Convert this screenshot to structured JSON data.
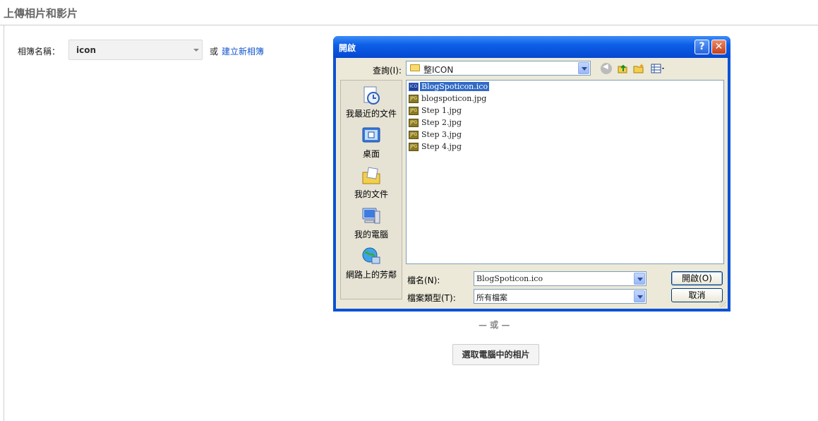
{
  "page": {
    "title": "上傳相片和影片",
    "album_label": "相簿名稱：",
    "album_value": "icon",
    "or_text": "或",
    "create_album_link": "建立新相簿",
    "or_divider": "— 或 —",
    "choose_button": "選取電腦中的相片"
  },
  "dialog": {
    "title": "開啟",
    "help_button": "?",
    "close_button": "✕",
    "lookin_label": "查詢(I):",
    "lookin_value": "整ICON",
    "places": [
      {
        "label": "我最近的文件",
        "icon": "recent-documents-icon"
      },
      {
        "label": "桌面",
        "icon": "desktop-icon"
      },
      {
        "label": "我的文件",
        "icon": "my-documents-icon"
      },
      {
        "label": "我的電腦",
        "icon": "my-computer-icon"
      },
      {
        "label": "網路上的芳鄰",
        "icon": "network-places-icon"
      }
    ],
    "files": [
      {
        "name": "BlogSpoticon.ico",
        "type": "ico",
        "selected": true
      },
      {
        "name": "blogspoticon.jpg",
        "type": "jpg"
      },
      {
        "name": "Step 1.jpg",
        "type": "jpg"
      },
      {
        "name": "Step 2.jpg",
        "type": "jpg"
      },
      {
        "name": "Step 3.jpg",
        "type": "jpg"
      },
      {
        "name": "Step 4.jpg",
        "type": "jpg"
      }
    ],
    "filename_label": "檔名(N):",
    "filename_value": "BlogSpoticon.ico",
    "filetype_label": "檔案類型(T):",
    "filetype_value": "所有檔案",
    "open_button": "開啟(O)",
    "cancel_button": "取消"
  },
  "colors": {
    "link": "#1155cc",
    "titlebar": "#0548d0",
    "dialog_bg": "#ece9d8",
    "selection": "#316ac5"
  }
}
